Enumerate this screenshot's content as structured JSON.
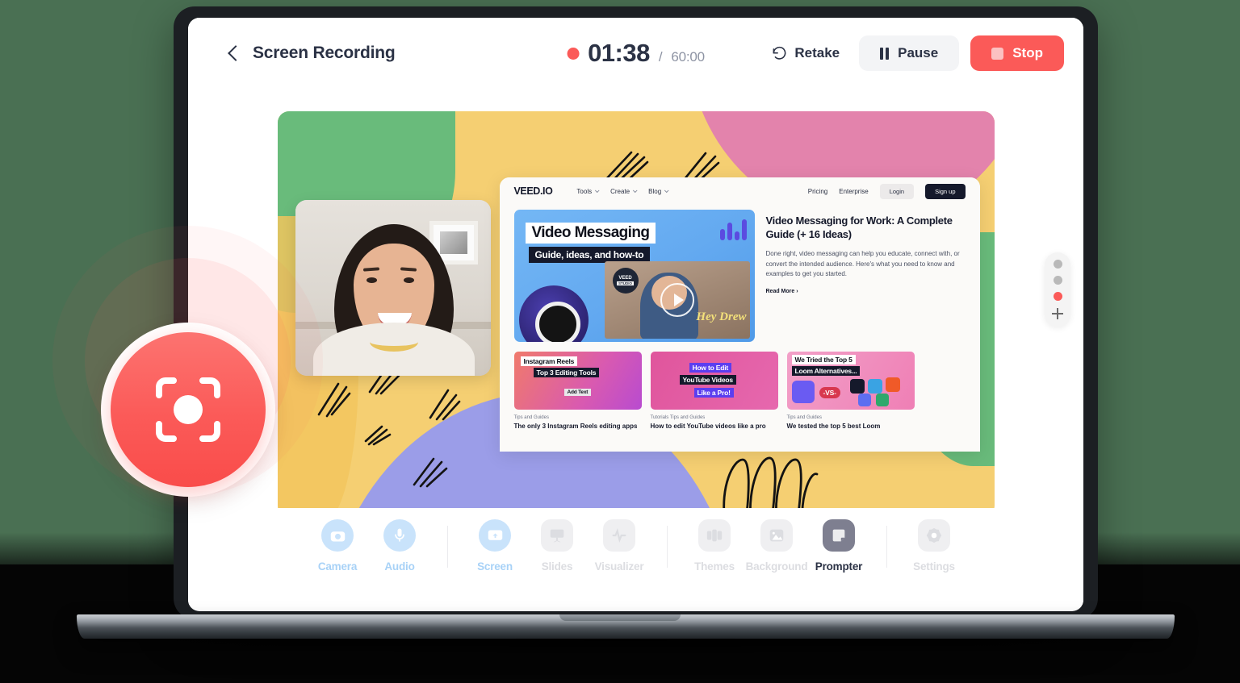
{
  "header": {
    "back_icon": "chevron-left-icon",
    "title": "Screen Recording",
    "timer": {
      "rec_dot": "record-dot-icon",
      "current": "01:38",
      "separator": "/",
      "total": "60:00"
    },
    "actions": {
      "retake": {
        "icon": "rotate-ccw-icon",
        "label": "Retake"
      },
      "pause": {
        "icon": "pause-icon",
        "label": "Pause"
      },
      "stop": {
        "icon": "stop-square-icon",
        "label": "Stop"
      }
    }
  },
  "colors": {
    "accent_red": "#fb5a58",
    "stop_red": "#fb5a58",
    "text_dark": "#2b3245",
    "muted": "#8d93a3",
    "blue_tool": "#a8d2f7",
    "canvas_yellow": "#f5cf72",
    "canvas_green": "#69bb7b",
    "canvas_pink": "#e383ac",
    "canvas_purple": "#9b9de8",
    "page_bg_green": "#4a7053"
  },
  "record_button": {
    "name": "record-screen-button",
    "icon": "screen-capture-record-icon",
    "color": "#fb5a58"
  },
  "canvas": {
    "webcam": {
      "name": "webcam-overlay",
      "alt": "Presenter webcam feed"
    },
    "site": {
      "logo": "VEED.IO",
      "nav": [
        {
          "label": "Tools",
          "has_dropdown": true
        },
        {
          "label": "Create",
          "has_dropdown": true
        },
        {
          "label": "Blog",
          "has_dropdown": true
        }
      ],
      "nav_right": [
        {
          "label": "Pricing"
        },
        {
          "label": "Enterprise"
        }
      ],
      "login_label": "Login",
      "signup_label": "Sign up",
      "hero": {
        "thumb_title": "Video Messaging",
        "thumb_subtitle": "Guide, ideas, and how-to",
        "thumb_badge": "VEED",
        "thumb_badge_sub": "STUDIO",
        "thumb_caption": "Hey Drew",
        "heading": "Video Messaging for Work: A Complete Guide (+ 16 Ideas)",
        "body": "Done right, video messaging can help you educate, connect with, or convert the intended audience. Here's what you need to know and examples to get you started.",
        "read_more": "Read More ›"
      },
      "cards": [
        {
          "thumb_line1": "Instagram Reels",
          "thumb_line2": "Top 3 Editing Tools",
          "thumb_line3": "Add Text",
          "category": "Tips and Guides",
          "title": "The only 3 Instagram Reels editing apps"
        },
        {
          "thumb_line1": "How to Edit",
          "thumb_line2": "YouTube Videos",
          "thumb_line3": "Like a Pro!",
          "category": "Tutorials   Tips and Guides",
          "title": "How to edit YouTube videos like a pro"
        },
        {
          "thumb_line1": "We Tried the Top 5",
          "thumb_line2": "Loom Alternatives...",
          "thumb_line3": "-VS-",
          "category": "Tips and Guides",
          "title": "We tested the top 5 best Loom"
        }
      ]
    },
    "side_dock": {
      "name": "layer-dock",
      "dots": [
        {
          "state": "inactive"
        },
        {
          "state": "inactive"
        },
        {
          "state": "active"
        }
      ],
      "add_icon": "plus-icon"
    }
  },
  "toolbar": {
    "groups": [
      {
        "items": [
          {
            "id": "camera",
            "label": "Camera",
            "icon": "camera-icon",
            "style": "blue",
            "shape": "round"
          },
          {
            "id": "audio",
            "label": "Audio",
            "icon": "microphone-icon",
            "style": "blue",
            "shape": "round"
          }
        ]
      },
      {
        "items": [
          {
            "id": "screen",
            "label": "Screen",
            "icon": "screen-share-icon",
            "style": "blue",
            "shape": "round"
          },
          {
            "id": "slides",
            "label": "Slides",
            "icon": "slides-icon",
            "style": "grey",
            "shape": "square"
          },
          {
            "id": "visualizer",
            "label": "Visualizer",
            "icon": "waveform-icon",
            "style": "grey",
            "shape": "square"
          }
        ]
      },
      {
        "items": [
          {
            "id": "themes",
            "label": "Themes",
            "icon": "themes-icon",
            "style": "grey",
            "shape": "square"
          },
          {
            "id": "background",
            "label": "Background",
            "icon": "image-icon",
            "style": "grey",
            "shape": "square"
          },
          {
            "id": "prompter",
            "label": "Prompter",
            "icon": "note-icon",
            "style": "active",
            "shape": "square"
          }
        ]
      },
      {
        "items": [
          {
            "id": "settings",
            "label": "Settings",
            "icon": "gear-icon",
            "style": "grey",
            "shape": "square"
          }
        ]
      }
    ]
  }
}
